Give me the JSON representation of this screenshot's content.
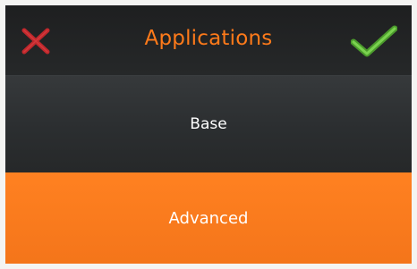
{
  "header": {
    "title": "Applications",
    "cancel_icon": "close-icon",
    "confirm_icon": "checkmark-icon"
  },
  "options": [
    {
      "label": "Base",
      "selected": false
    },
    {
      "label": "Advanced",
      "selected": true
    }
  ],
  "colors": {
    "accent": "#ff7a1a",
    "background": "#222425",
    "cancel": "#c0282c",
    "confirm": "#5fb83a",
    "selected": "#f77a1d"
  }
}
